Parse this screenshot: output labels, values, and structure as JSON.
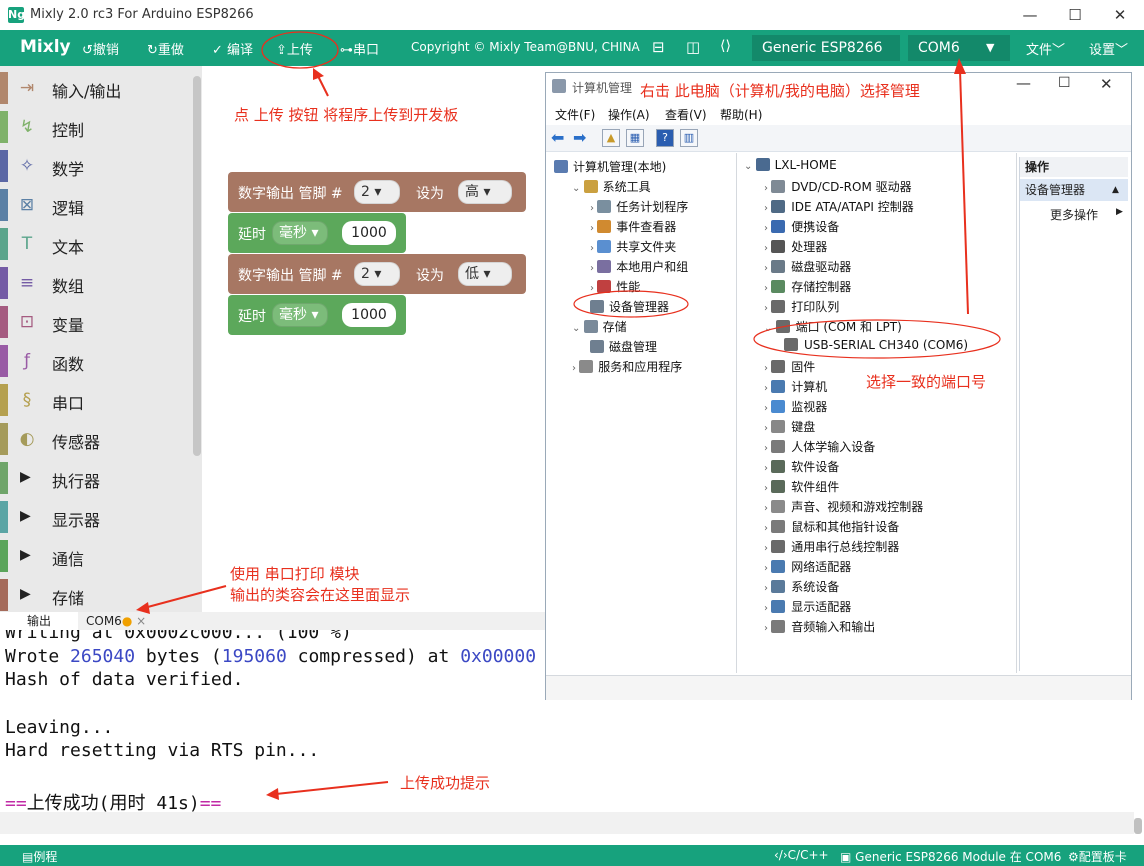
{
  "window": {
    "title": "Mixly 2.0 rc3 For Arduino ESP8266",
    "logo": "Ng"
  },
  "toolbar": {
    "brand": "Mixly",
    "undo": "撤销",
    "redo": "重做",
    "compile": "编译",
    "upload": "上传",
    "serial": "串口",
    "copyright": "Copyright © Mixly Team@BNU, CHINA",
    "board": "Generic ESP8266",
    "port": "COM6",
    "file": "文件",
    "settings": "设置"
  },
  "sidebar": {
    "categories": [
      {
        "label": "输入/输出",
        "icon": "io-icon",
        "color": "#b1876d"
      },
      {
        "label": "控制",
        "icon": "control-icon",
        "color": "#7fb26a"
      },
      {
        "label": "数学",
        "icon": "math-icon",
        "color": "#5b67a5"
      },
      {
        "label": "逻辑",
        "icon": "logic-icon",
        "color": "#5b80a5"
      },
      {
        "label": "文本",
        "icon": "text-icon",
        "color": "#5ba58c"
      },
      {
        "label": "数组",
        "icon": "list-icon",
        "color": "#745ba5"
      },
      {
        "label": "变量",
        "icon": "variable-icon",
        "color": "#a55b80"
      },
      {
        "label": "函数",
        "icon": "function-icon",
        "color": "#995ba5"
      },
      {
        "label": "串口",
        "icon": "serial-icon",
        "color": "#b5a04f"
      },
      {
        "label": "传感器",
        "icon": "sensor-icon",
        "color": "#a59b5b"
      },
      {
        "label": "执行器",
        "icon": "expand-triangle",
        "color": "#6fa56a"
      },
      {
        "label": "显示器",
        "icon": "expand-triangle",
        "color": "#5ba5a5"
      },
      {
        "label": "通信",
        "icon": "expand-triangle",
        "color": "#5ba55b"
      },
      {
        "label": "存储",
        "icon": "expand-triangle",
        "color": "#a56b5b"
      }
    ]
  },
  "blocks": {
    "digital_write": "数字输出 管脚 #",
    "pin": "2",
    "set_as": "设为",
    "high": "高",
    "low": "低",
    "delay": "延时",
    "unit": "毫秒",
    "ms": "1000"
  },
  "annotations": {
    "upload_hint": "点 上传 按钮 将程序上传到开发板",
    "manage_hint": "右击 此电脑（计算机/我的电脑）选择管理",
    "port_hint": "选择一致的端口号",
    "serial_hint_1": "使用 串口打印 模块",
    "serial_hint_2": "输出的类容会在这里面显示",
    "success_hint": "上传成功提示"
  },
  "output": {
    "tabs": [
      "输出",
      "COM6"
    ],
    "lines": [
      "Writing at 0x0002c000... (100 %)",
      "Hash of data verified.",
      "",
      "Leaving...",
      "Hard resetting via RTS pin..."
    ],
    "wrote_prefix": "Wrote ",
    "wrote_bytes": "265040",
    "wrote_mid1": " bytes (",
    "wrote_comp": "195060",
    "wrote_mid2": " compressed) at ",
    "wrote_addr": "0x00000",
    "success_eq": "==",
    "success_text": "上传成功(用时 41s)"
  },
  "status": {
    "examples": "例程",
    "lang": "C/C++",
    "board_status": "Generic ESP8266 Module 在 COM6",
    "config": "配置板卡"
  },
  "cm": {
    "title": "计算机管理",
    "menu": [
      "文件(F)",
      "操作(A)",
      "查看(V)",
      "帮助(H)"
    ],
    "left_tree": [
      {
        "label": "计算机管理(本地)",
        "level": 0,
        "exp": ""
      },
      {
        "label": "系统工具",
        "level": 1,
        "exp": "v"
      },
      {
        "label": "任务计划程序",
        "level": 2,
        "exp": ">"
      },
      {
        "label": "事件查看器",
        "level": 2,
        "exp": ">"
      },
      {
        "label": "共享文件夹",
        "level": 2,
        "exp": ">"
      },
      {
        "label": "本地用户和组",
        "level": 2,
        "exp": ">"
      },
      {
        "label": "性能",
        "level": 2,
        "exp": ">"
      },
      {
        "label": "设备管理器",
        "level": 2,
        "exp": ""
      },
      {
        "label": "存储",
        "level": 1,
        "exp": "v"
      },
      {
        "label": "磁盘管理",
        "level": 2,
        "exp": ""
      },
      {
        "label": "服务和应用程序",
        "level": 1,
        "exp": ">"
      }
    ],
    "devices_root": "LXL-HOME",
    "devices": [
      {
        "label": "DVD/CD-ROM 驱动器",
        "level": 1,
        "exp": ">"
      },
      {
        "label": "IDE ATA/ATAPI 控制器",
        "level": 1,
        "exp": ">"
      },
      {
        "label": "便携设备",
        "level": 1,
        "exp": ">"
      },
      {
        "label": "处理器",
        "level": 1,
        "exp": ">"
      },
      {
        "label": "磁盘驱动器",
        "level": 1,
        "exp": ">"
      },
      {
        "label": "存储控制器",
        "level": 1,
        "exp": ">"
      },
      {
        "label": "打印队列",
        "level": 1,
        "exp": ">"
      },
      {
        "label": "端口 (COM 和 LPT)",
        "level": 1,
        "exp": "v"
      },
      {
        "label": "USB-SERIAL CH340 (COM6)",
        "level": 2,
        "exp": ""
      },
      {
        "label": "固件",
        "level": 1,
        "exp": ">"
      },
      {
        "label": "计算机",
        "level": 1,
        "exp": ">"
      },
      {
        "label": "监视器",
        "level": 1,
        "exp": ">"
      },
      {
        "label": "键盘",
        "level": 1,
        "exp": ">"
      },
      {
        "label": "人体学输入设备",
        "level": 1,
        "exp": ">"
      },
      {
        "label": "软件设备",
        "level": 1,
        "exp": ">"
      },
      {
        "label": "软件组件",
        "level": 1,
        "exp": ">"
      },
      {
        "label": "声音、视频和游戏控制器",
        "level": 1,
        "exp": ">"
      },
      {
        "label": "鼠标和其他指针设备",
        "level": 1,
        "exp": ">"
      },
      {
        "label": "通用串行总线控制器",
        "level": 1,
        "exp": ">"
      },
      {
        "label": "网络适配器",
        "level": 1,
        "exp": ">"
      },
      {
        "label": "系统设备",
        "level": 1,
        "exp": ">"
      },
      {
        "label": "显示适配器",
        "level": 1,
        "exp": ">"
      },
      {
        "label": "音频输入和输出",
        "level": 1,
        "exp": ">"
      }
    ],
    "actions_header": "操作",
    "actions_sel": "设备管理器",
    "actions_more": "更多操作"
  }
}
